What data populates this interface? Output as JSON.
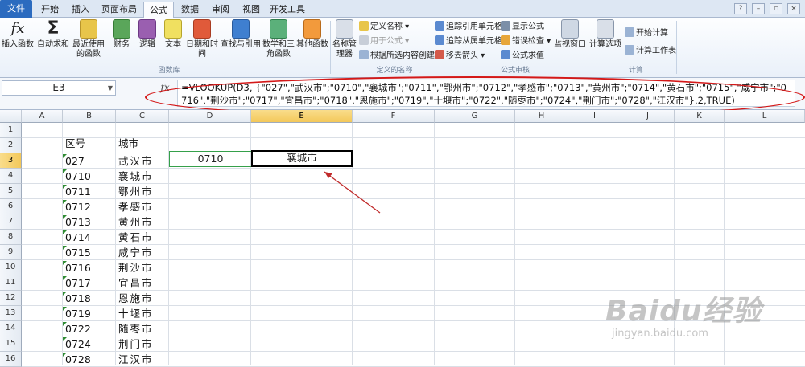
{
  "tabs": [
    "文件",
    "开始",
    "插入",
    "页面布局",
    "公式",
    "数据",
    "审阅",
    "视图",
    "开发工具"
  ],
  "ribbon": {
    "big_buttons": [
      "插入函数",
      "自动求和",
      "最近使用的函数",
      "财务",
      "逻辑",
      "文本",
      "日期和时间",
      "查找与引用",
      "数学和三角函数",
      "其他函数",
      "名称管理器",
      "监视窗口",
      "计算选项"
    ],
    "define_names": [
      "定义名称",
      "用于公式",
      "根据所选内容创建"
    ],
    "audit": [
      "追踪引用单元格",
      "追踪从属单元格",
      "移去箭头",
      "显示公式",
      "错误检查",
      "公式求值"
    ],
    "calc": [
      "开始计算",
      "计算工作表"
    ],
    "groups": [
      "函数库",
      "定义的名称",
      "公式审核",
      "计算"
    ]
  },
  "formula_bar": {
    "name_box": "E3",
    "fx_label": "fx",
    "formula": "=VLOOKUP(D3, {\"027\",\"武汉市\";\"0710\",\"襄城市\";\"0711\",\"鄂州市\";\"0712\",\"孝感市\";\"0713\",\"黄州市\";\"0714\",\"黄石市\";\"0715\",\"咸宁市\";\"0716\",\"荆沙市\";\"0717\",\"宜昌市\";\"0718\",\"恩施市\";\"0719\",\"十堰市\";\"0722\",\"随枣市\";\"0724\",\"荆门市\";\"0728\",\"江汉市\"},2,TRUE)"
  },
  "grid": {
    "columns": [
      "A",
      "B",
      "C",
      "D",
      "E",
      "F",
      "G",
      "H",
      "I",
      "J",
      "K",
      "L"
    ],
    "rows": [
      "1",
      "2",
      "3",
      "4",
      "5",
      "6",
      "7",
      "8",
      "9",
      "10",
      "11",
      "12",
      "13",
      "14",
      "15",
      "16"
    ],
    "header_b": "区号",
    "header_c": "城市",
    "codes": [
      "027",
      "0710",
      "0711",
      "0712",
      "0713",
      "0714",
      "0715",
      "0716",
      "0717",
      "0718",
      "0719",
      "0722",
      "0724",
      "0728"
    ],
    "cities": [
      "武汉市",
      "襄城市",
      "鄂州市",
      "孝感市",
      "黄州市",
      "黄石市",
      "咸宁市",
      "荆沙市",
      "宜昌市",
      "恩施市",
      "十堰市",
      "随枣市",
      "荆门市",
      "江汉市"
    ],
    "d3": "0710",
    "e3": "襄城市"
  },
  "watermark": {
    "brand": "Baidu经验",
    "url": "jingyan.baidu.com"
  },
  "colors": {
    "accent": "#2b6bbf",
    "annotation": "#d41818",
    "selection": "#f3c85a"
  }
}
